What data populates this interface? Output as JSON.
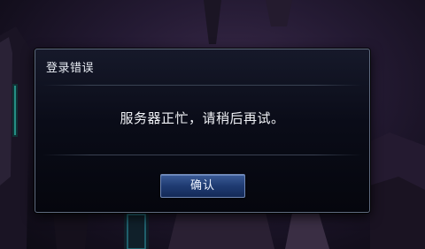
{
  "dialog": {
    "title": "登录错误",
    "message": "服务器正忙，请稍后再试。",
    "confirm_label": "确认"
  },
  "colors": {
    "dialog_border": "#5f6b80",
    "button_fill": "#1f3b72",
    "text": "#f1f3f7"
  }
}
